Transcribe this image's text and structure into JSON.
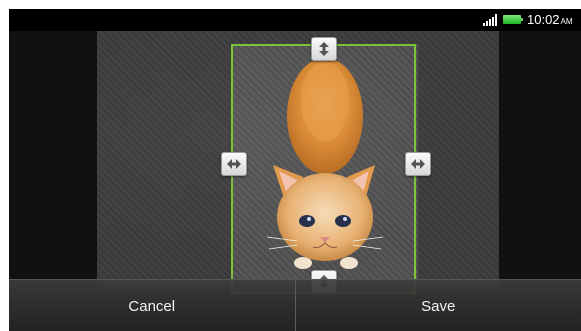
{
  "status_bar": {
    "time": "10:02",
    "ampm": "AM",
    "icons": [
      "signal-icon",
      "battery-icon"
    ]
  },
  "editor": {
    "image_subject": "kitten-photo",
    "crop_handles": [
      "handle-top",
      "handle-left",
      "handle-right",
      "handle-bottom"
    ],
    "accent_color": "#7cc23a"
  },
  "actions": {
    "cancel_label": "Cancel",
    "save_label": "Save"
  }
}
